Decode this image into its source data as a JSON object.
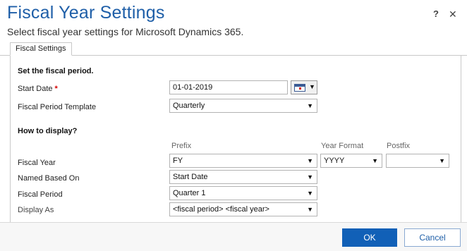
{
  "dialog": {
    "title": "Fiscal Year Settings",
    "subtitle": "Select fiscal year settings for Microsoft Dynamics 365.",
    "help_glyph": "?",
    "close_glyph": "✕"
  },
  "tabs": [
    {
      "label": "Fiscal Settings",
      "selected": true
    }
  ],
  "fiscal_period": {
    "heading": "Set the fiscal period.",
    "start_date": {
      "label": "Start Date",
      "required_mark": "*",
      "value": "01-01-2019"
    },
    "template": {
      "label": "Fiscal Period Template",
      "value": "Quarterly"
    }
  },
  "display": {
    "heading": "How to display?",
    "columns": {
      "prefix": "Prefix",
      "year_format": "Year Format",
      "postfix": "Postfix"
    },
    "fiscal_year": {
      "label": "Fiscal Year",
      "prefix": "FY",
      "year_format": "YYYY",
      "postfix": ""
    },
    "named_based_on": {
      "label": "Named Based On",
      "value": "Start Date"
    },
    "fiscal_period": {
      "label": "Fiscal Period",
      "value": "Quarter 1"
    },
    "display_as": {
      "label": "Display As",
      "value": "<fiscal period> <fiscal year>"
    }
  },
  "buttons": {
    "ok": "OK",
    "cancel": "Cancel"
  },
  "dropdown_arrow": "▼",
  "colors": {
    "title": "#1f5fa8",
    "primary_button": "#1160b7",
    "required": "#d40000"
  }
}
